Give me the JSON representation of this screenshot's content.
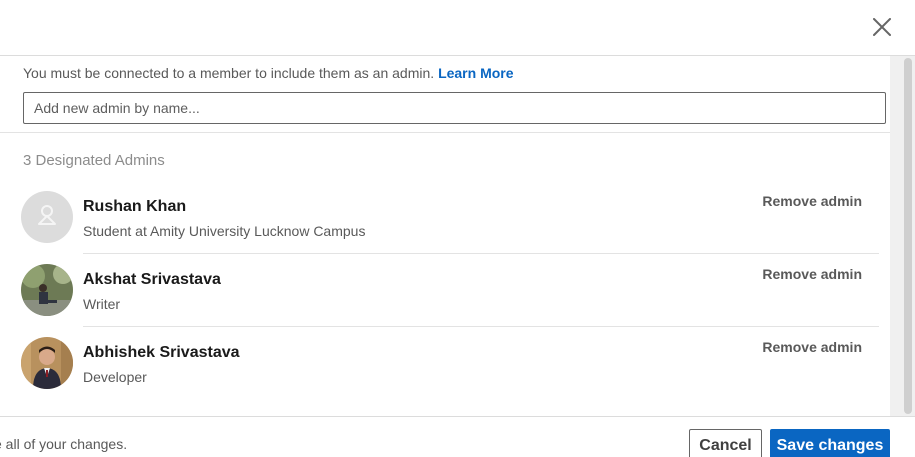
{
  "header": {
    "close_icon": "close-icon"
  },
  "helper": {
    "text": "You must be connected to a member to include them as an admin.",
    "link": "Learn More"
  },
  "search": {
    "placeholder": "Add new admin by name...",
    "value": ""
  },
  "admins_count_label": "3 Designated Admins",
  "admins": [
    {
      "name": "Rushan Khan",
      "headline": "Student at Amity University Lucknow Campus",
      "remove_label": "Remove admin",
      "avatar": "default-person-icon"
    },
    {
      "name": "Akshat Srivastava",
      "headline": "Writer",
      "remove_label": "Remove admin",
      "avatar": "photo"
    },
    {
      "name": "Abhishek Srivastava",
      "headline": "Developer",
      "remove_label": "Remove admin",
      "avatar": "photo"
    }
  ],
  "footer": {
    "note": "e all of your changes.",
    "cancel_label": "Cancel",
    "save_label": "Save changes"
  },
  "colors": {
    "accent": "#0a66c2",
    "muted_text": "#595959",
    "divider": "#e3e3e3"
  }
}
